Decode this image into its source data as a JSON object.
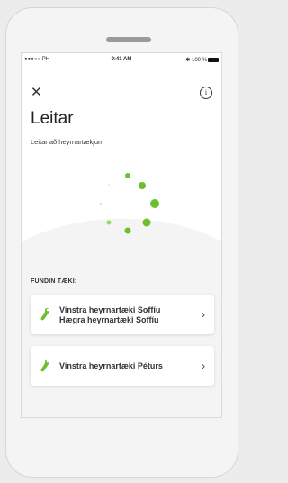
{
  "status_bar": {
    "carrier": "●●●○○ PH",
    "time": "9:41 AM",
    "battery": "100 %"
  },
  "header": {
    "title": "Leitar",
    "subtitle": "Leitar að heyrnartækjum"
  },
  "section_label": "FUNDIN TÆKI:",
  "devices": [
    {
      "line1": "Vinstra heyrnartæki Soffíu",
      "line2": "Hægra heyrnartæki Soffíu"
    },
    {
      "line1": "Vinstra heyrnartæki Péturs"
    }
  ],
  "colors": {
    "accent": "#6cbf2e",
    "background": "#f4f4f4"
  },
  "icons": {
    "close": "close-icon",
    "info": "info-icon",
    "device": "hearing-aid-icon",
    "chevron": "chevron-right-icon"
  }
}
